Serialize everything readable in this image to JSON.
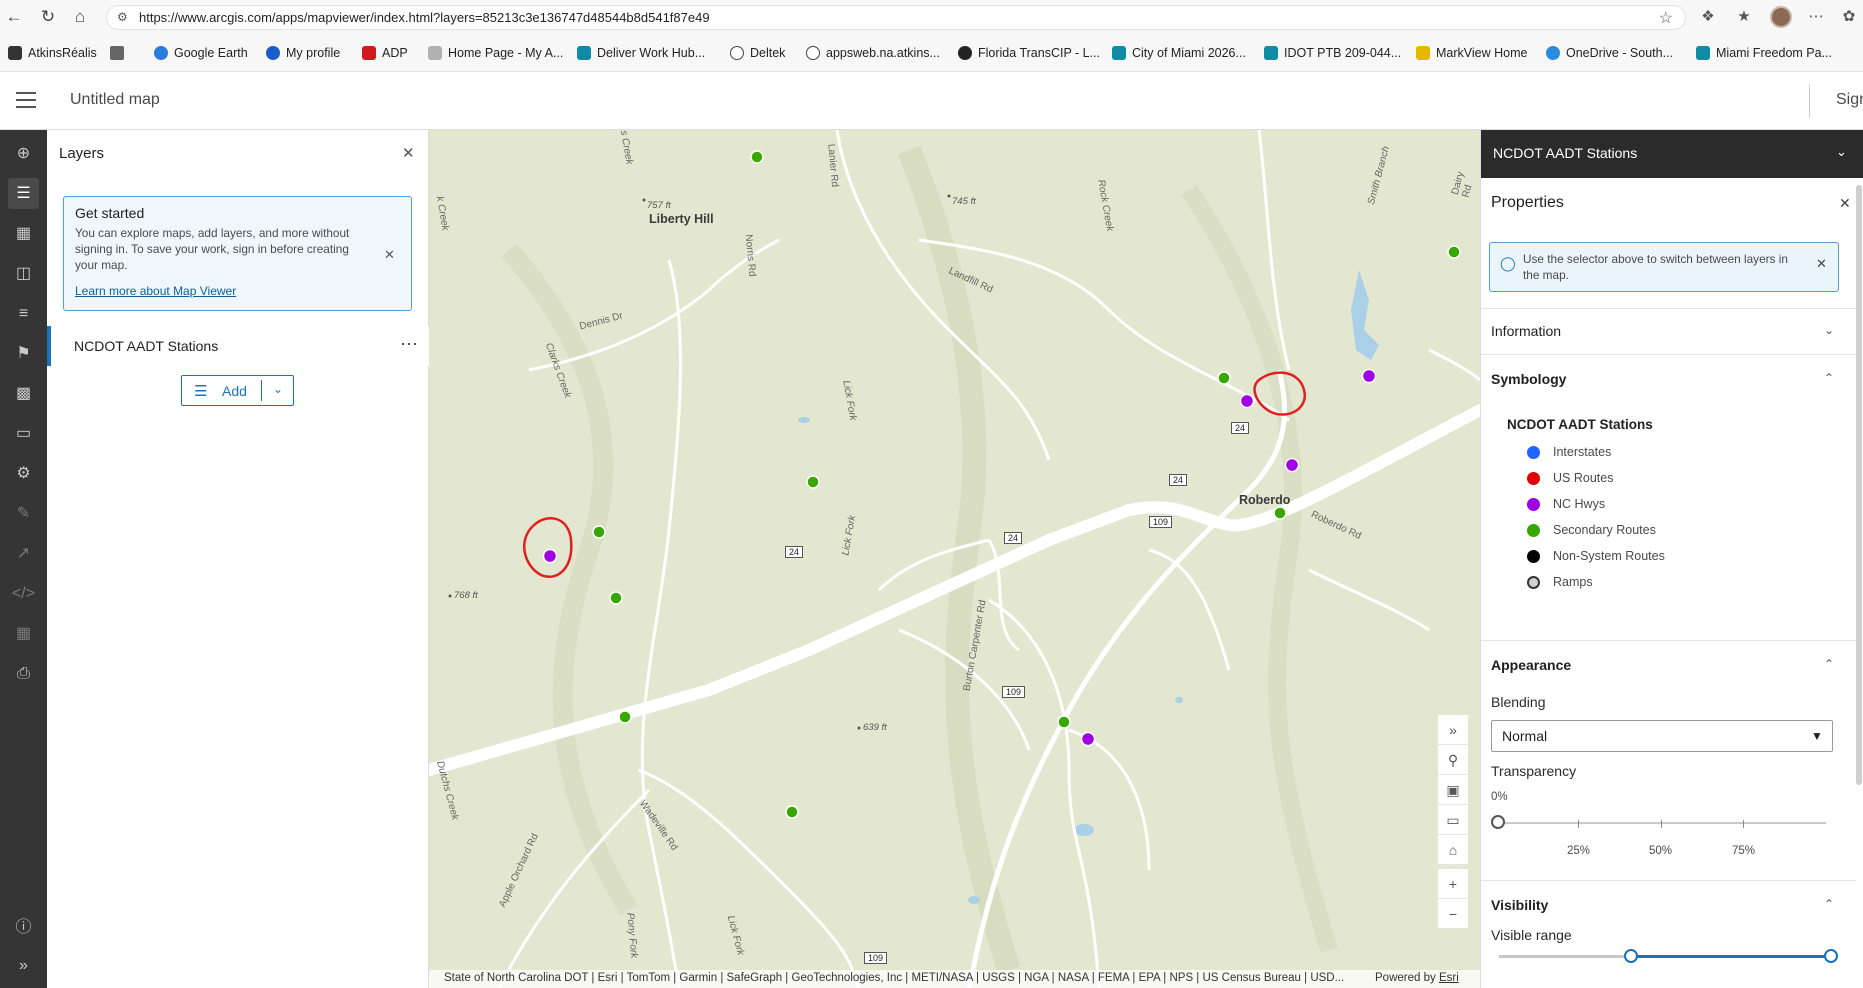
{
  "browser": {
    "url": "https://www.arcgis.com/apps/mapviewer/index.html?layers=85213c3e136747d48544b8d541f87e49",
    "bookmarks": [
      "AtkinsRéalis",
      "Google Earth",
      "My profile",
      "ADP",
      "Home Page - My A...",
      "Deliver Work Hub...",
      "Deltek",
      "appsweb.na.atkins...",
      "Florida TransCIP - L...",
      "City of Miami 2026...",
      "IDOT PTB 209-044...",
      "MarkView Home",
      "OneDrive - South...",
      "Miami Freedom Pa..."
    ]
  },
  "header": {
    "title": "Untitled map",
    "sign_in": "Sign"
  },
  "layers_panel": {
    "title": "Layers",
    "get_started": {
      "title": "Get started",
      "body": "You can explore maps, add layers, and more without signing in. To save your work, sign in before creating your map.",
      "link": "Learn more about Map Viewer"
    },
    "layer_name": "NCDOT AADT Stations",
    "add_label": "Add"
  },
  "map": {
    "labels": {
      "liberty_hill": "Liberty Hill",
      "roberdo": "Roberdo",
      "dennis_dr": "Dennis Dr",
      "clarks_creek": "Clarks Creek",
      "norris_rd": "Norris Rd",
      "lick_fork": "Lick Fork",
      "lick_fork2": "Lick Fork",
      "landfill_rd": "Landfill Rd",
      "rock_creek": "Rock Creek",
      "smith_branch": "Smith Branch",
      "dairy_rd": "Dairy Rd",
      "roberdo_rd": "Roberdo Rd",
      "burton_carpenter_rd": "Burton Carpenter Rd",
      "wadeville_rd": "Wadeville Rd",
      "apple_orchard_rd": "Apple Orchard Rd",
      "dutchs_creek": "Dutchs Creek",
      "lanier_rd": "Lanier Rd",
      "lick_fork3": "Lick Fork",
      "pony_fork": "Pony Fork",
      "s_creek": "s Creek",
      "k_creek": "k Creek",
      "elev_757": "757 ft",
      "elev_745": "745 ft",
      "elev_768": "768 ft",
      "elev_639": "639 ft"
    },
    "shields": {
      "r24a": "24",
      "r24b": "24",
      "r24c": "24",
      "r24d": "24",
      "r109a": "109",
      "r109b": "109",
      "r109c": "109"
    },
    "attribution": "State of North Carolina DOT | Esri | TomTom | Garmin | SafeGraph | GeoTechnologies, Inc | METI/NASA | USGS | NGA | NASA | FEMA | EPA | NPS | US Census Bureau | USD...",
    "powered_by": "Powered by",
    "powered_by_link": "Esri"
  },
  "right_panel": {
    "layer_selector": "NCDOT AADT Stations",
    "properties_title": "Properties",
    "hint": "Use the selector above to switch between layers in the map.",
    "information": "Information",
    "symbology": "Symbology",
    "legend_title": "NCDOT AADT Stations",
    "legend": [
      {
        "label": "Interstates",
        "color": "#1e64ff"
      },
      {
        "label": "US Routes",
        "color": "#e00000"
      },
      {
        "label": "NC Hwys",
        "color": "#a000e6"
      },
      {
        "label": "Secondary Routes",
        "color": "#38a800"
      },
      {
        "label": "Non-System Routes",
        "color": "#000000"
      },
      {
        "label": "Ramps",
        "color": "#d0d0d0"
      }
    ],
    "appearance": "Appearance",
    "blending_label": "Blending",
    "blending_value": "Normal",
    "transparency_label": "Transparency",
    "transparency_value": "0%",
    "transparency_ticks": [
      "25%",
      "50%",
      "75%"
    ],
    "visibility": "Visibility",
    "visible_range": "Visible range"
  }
}
